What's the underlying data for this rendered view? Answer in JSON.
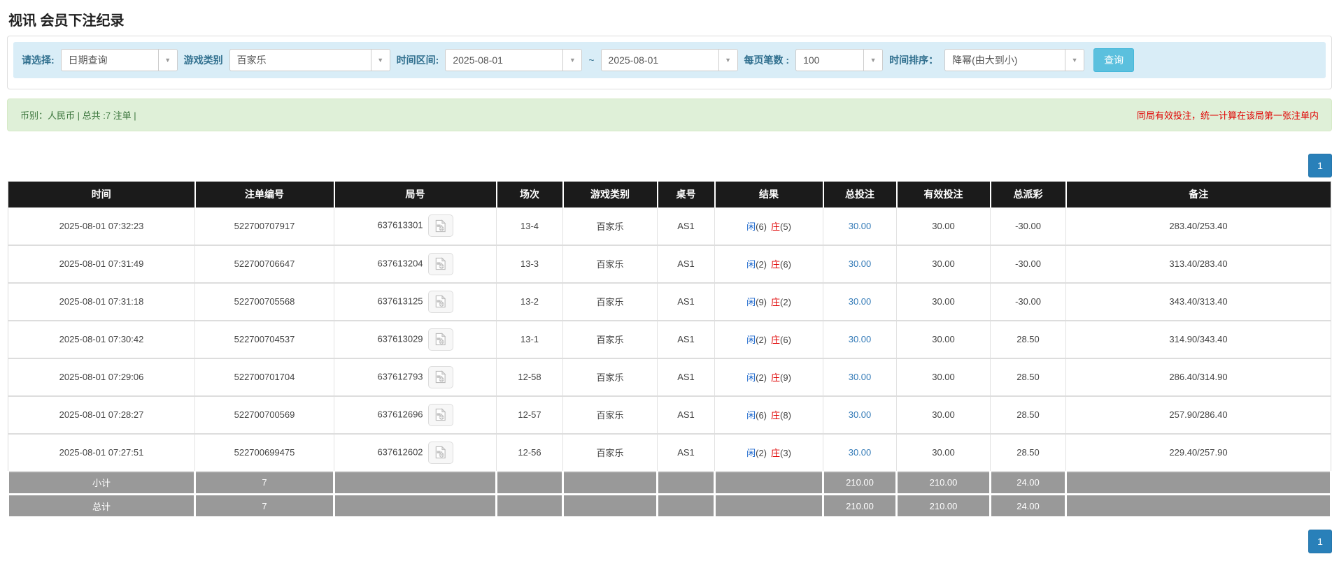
{
  "page": {
    "title": "视讯 会员下注纪录"
  },
  "filters": {
    "select_label": "请选择:",
    "select_value": "日期查询",
    "game_type_label": "游戏类别",
    "game_type_value": "百家乐",
    "time_range_label": "时间区间:",
    "date_from": "2025-08-01",
    "date_separator": "~",
    "date_to": "2025-08-01",
    "page_size_label": "每页笔数 :",
    "page_size_value": "100",
    "sort_label": "时间排序：",
    "sort_value": "降幂(由大到小)",
    "search_button": "查询",
    "caret": "▼"
  },
  "summary": {
    "left_text": "币别：人民币 | 总共 :7 注单 |",
    "right_text": "同局有效投注，统一计算在该局第一张注单内"
  },
  "pagination": {
    "page": "1"
  },
  "table": {
    "headers": [
      "时间",
      "注单编号",
      "局号",
      "场次",
      "游戏类别",
      "桌号",
      "结果",
      "总投注",
      "有效投注",
      "总派彩",
      "备注"
    ],
    "rows": [
      {
        "time": "2025-08-01 07:32:23",
        "bet_id": "522700707917",
        "round_id": "637613301",
        "session": "13-4",
        "game": "百家乐",
        "table_no": "AS1",
        "result_player": "闲",
        "result_player_num": "(6)",
        "result_banker": "庄",
        "result_banker_num": "(5)",
        "total_bet": "30.00",
        "valid_bet": "30.00",
        "payout": "-30.00",
        "remark": "283.40/253.40"
      },
      {
        "time": "2025-08-01 07:31:49",
        "bet_id": "522700706647",
        "round_id": "637613204",
        "session": "13-3",
        "game": "百家乐",
        "table_no": "AS1",
        "result_player": "闲",
        "result_player_num": "(2)",
        "result_banker": "庄",
        "result_banker_num": "(6)",
        "total_bet": "30.00",
        "valid_bet": "30.00",
        "payout": "-30.00",
        "remark": "313.40/283.40"
      },
      {
        "time": "2025-08-01 07:31:18",
        "bet_id": "522700705568",
        "round_id": "637613125",
        "session": "13-2",
        "game": "百家乐",
        "table_no": "AS1",
        "result_player": "闲",
        "result_player_num": "(9)",
        "result_banker": "庄",
        "result_banker_num": "(2)",
        "total_bet": "30.00",
        "valid_bet": "30.00",
        "payout": "-30.00",
        "remark": "343.40/313.40"
      },
      {
        "time": "2025-08-01 07:30:42",
        "bet_id": "522700704537",
        "round_id": "637613029",
        "session": "13-1",
        "game": "百家乐",
        "table_no": "AS1",
        "result_player": "闲",
        "result_player_num": "(2)",
        "result_banker": "庄",
        "result_banker_num": "(6)",
        "total_bet": "30.00",
        "valid_bet": "30.00",
        "payout": "28.50",
        "remark": "314.90/343.40"
      },
      {
        "time": "2025-08-01 07:29:06",
        "bet_id": "522700701704",
        "round_id": "637612793",
        "session": "12-58",
        "game": "百家乐",
        "table_no": "AS1",
        "result_player": "闲",
        "result_player_num": "(2)",
        "result_banker": "庄",
        "result_banker_num": "(9)",
        "total_bet": "30.00",
        "valid_bet": "30.00",
        "payout": "28.50",
        "remark": "286.40/314.90"
      },
      {
        "time": "2025-08-01 07:28:27",
        "bet_id": "522700700569",
        "round_id": "637612696",
        "session": "12-57",
        "game": "百家乐",
        "table_no": "AS1",
        "result_player": "闲",
        "result_player_num": "(6)",
        "result_banker": "庄",
        "result_banker_num": "(8)",
        "total_bet": "30.00",
        "valid_bet": "30.00",
        "payout": "28.50",
        "remark": "257.90/286.40"
      },
      {
        "time": "2025-08-01 07:27:51",
        "bet_id": "522700699475",
        "round_id": "637612602",
        "session": "12-56",
        "game": "百家乐",
        "table_no": "AS1",
        "result_player": "闲",
        "result_player_num": "(2)",
        "result_banker": "庄",
        "result_banker_num": "(3)",
        "total_bet": "30.00",
        "valid_bet": "30.00",
        "payout": "28.50",
        "remark": "229.40/257.90"
      }
    ],
    "subtotal": {
      "label": "小计",
      "count": "7",
      "total_bet": "210.00",
      "valid_bet": "210.00",
      "payout": "24.00"
    },
    "total": {
      "label": "总计",
      "count": "7",
      "total_bet": "210.00",
      "valid_bet": "210.00",
      "payout": "24.00"
    }
  },
  "colors": {
    "header_bg": "#1b1b1b",
    "footer_bg": "#999999",
    "filter_bar_bg": "#d9edf7",
    "filter_label": "#31708f",
    "summary_bg": "#dff0d8",
    "summary_text": "#3c763d",
    "warning_red": "#e00000",
    "player_blue": "#1a66cc",
    "banker_red": "#e00000",
    "link_blue": "#337ab7",
    "search_button_bg": "#5bc0de",
    "pagination_bg": "#2980b9"
  }
}
